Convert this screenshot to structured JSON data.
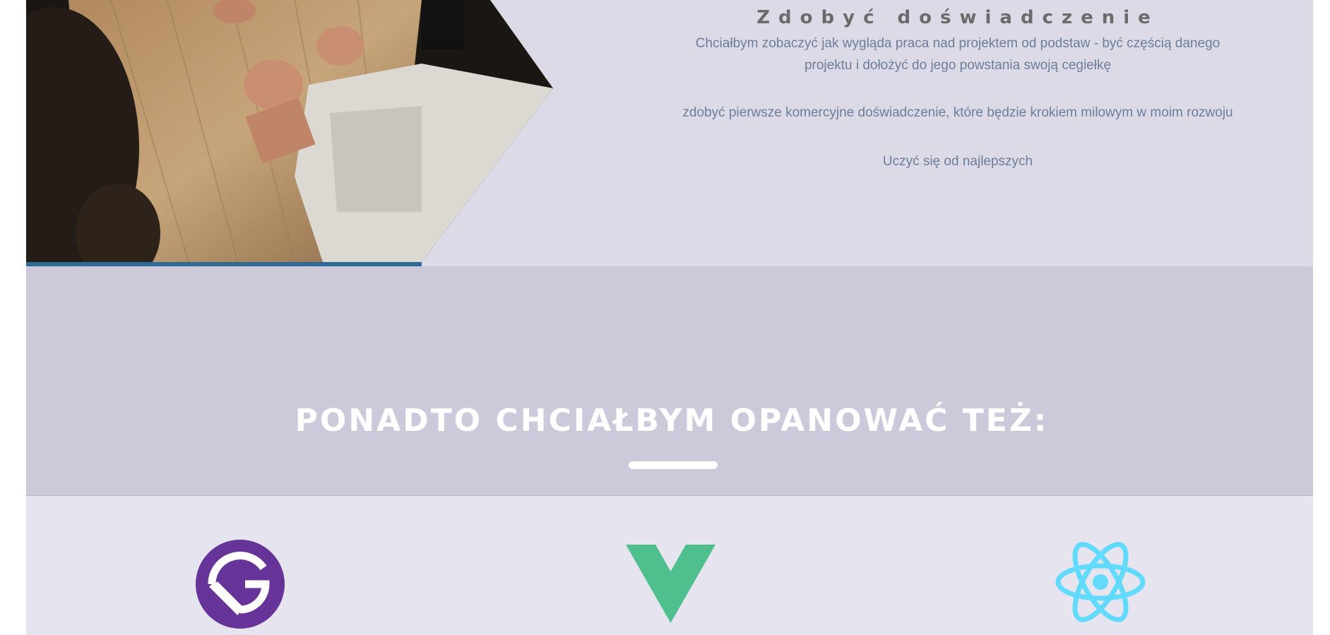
{
  "goal": {
    "title": "Zdobyć doświadczenie",
    "paragraphs": [
      "Chciałbym zobaczyć jak wygląda praca nad projektem od podstaw - być częścią danego projektu i dołożyć do jego powstania swoją cegiełkę",
      "zdobyć pierwsze komercyjne doświadczenie, które będzie krokiem milowym w moim rozwoju",
      "Uczyć się od najlepszych"
    ]
  },
  "more": {
    "heading": "PONADTO CHCIAŁBYM OPANOWAĆ TEŻ:"
  },
  "technologies": [
    {
      "icon": "gatsby-logo-icon",
      "color": "#663399"
    },
    {
      "icon": "vue-logo-icon",
      "color": "#4fc08d"
    },
    {
      "icon": "react-logo-icon",
      "color": "#61dafb"
    }
  ],
  "colors": {
    "accent_stripe": "#2e6a96",
    "top_bg": "#dcdae6",
    "band_bg": "#ccc9db",
    "bottom_bg": "#e6e4ef"
  }
}
